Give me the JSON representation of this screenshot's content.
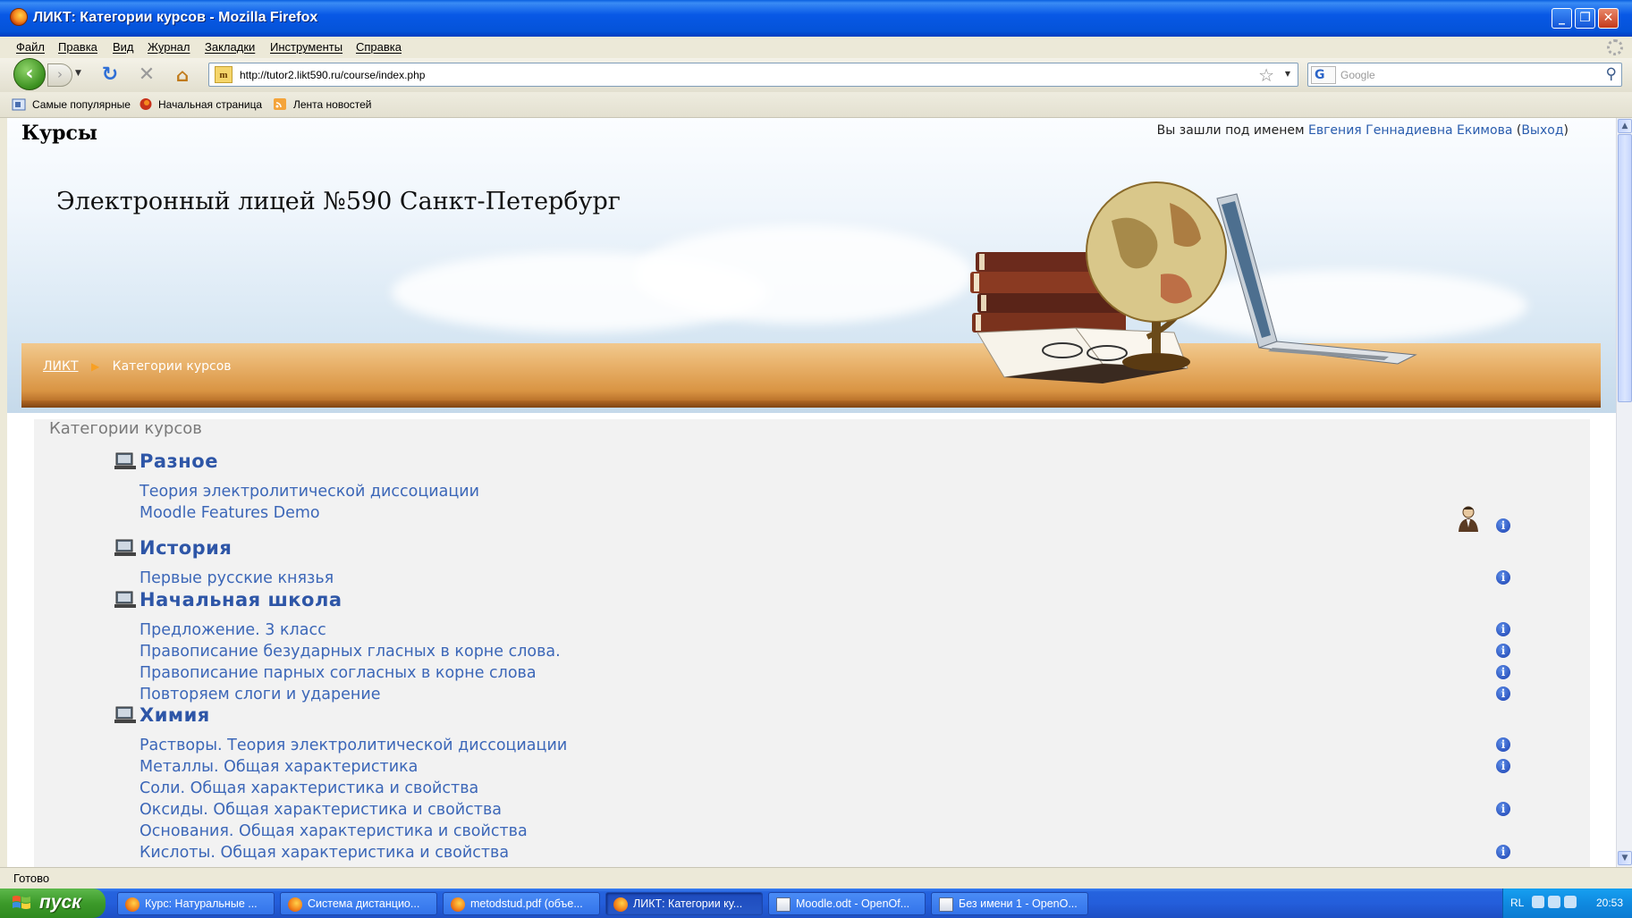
{
  "window": {
    "title": "ЛИКТ: Категории курсов - Mozilla Firefox"
  },
  "menu": [
    "Файл",
    "Правка",
    "Вид",
    "Журнал",
    "Закладки",
    "Инструменты",
    "Справка"
  ],
  "nav": {
    "url": "http://tutor2.likt590.ru/course/index.php",
    "search_placeholder": "Google"
  },
  "bookmarks": [
    "Самые популярные",
    "Начальная страница",
    "Лента новостей"
  ],
  "page": {
    "heading": "Курсы",
    "login_prefix": "Вы зашли под именем",
    "user_name": "Евгения Геннадиевна Екимова",
    "logout": "Выход",
    "site_title": "Электронный лицей №590 Санкт-Петербург",
    "breadcrumb_home": "ЛИКТ",
    "breadcrumb_current": "Категории курсов",
    "main_title": "Категории курсов"
  },
  "categories": [
    {
      "name": "Разное",
      "courses": [
        "Теория электролитической диссоциации",
        "Moodle Features Demo"
      ]
    },
    {
      "name": "История",
      "courses": [
        "Первые русские князья"
      ]
    },
    {
      "name": "Начальная школа",
      "courses": [
        "Предложение. 3 класс",
        "Правописание безударных гласных в корне слова.",
        "Правописание парных согласных в корне слова",
        "Повторяем слоги и ударение"
      ]
    },
    {
      "name": "Химия",
      "courses": [
        "Растворы. Теория электролитической диссоциации",
        "Металлы. Общая характеристика",
        "Соли. Общая характеристика и свойства",
        "Оксиды. Общая характеристика и свойства",
        "Основания. Общая характеристика и свойства",
        "Кислоты. Общая характеристика и свойства"
      ]
    }
  ],
  "status": "Готово",
  "taskbar": {
    "start": "пуск",
    "tasks": [
      "Курс: Натуральные ...",
      "Система дистанцио...",
      "metodstud.pdf (объе...",
      "ЛИКТ: Категории ку...",
      "Moodle.odt - OpenOf...",
      "Без имени 1 - OpenO..."
    ],
    "lang": "RL",
    "clock": "20:53"
  },
  "colors": {
    "link": "#3c67b8",
    "category": "#2e56a7",
    "titlebar": "#0858e6"
  },
  "icons": {
    "category": "category-monitor-icon",
    "info": "info-icon",
    "teacher": "teacher-icon"
  }
}
